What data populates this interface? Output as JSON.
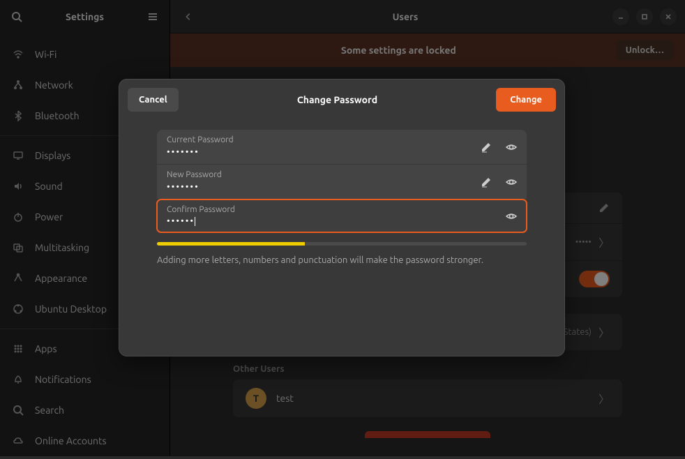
{
  "sidebar": {
    "title": "Settings",
    "items": [
      {
        "label": "Wi-Fi",
        "icon": "wifi"
      },
      {
        "label": "Network",
        "icon": "network"
      },
      {
        "label": "Bluetooth",
        "icon": "bluetooth"
      },
      {
        "divider": true
      },
      {
        "label": "Displays",
        "icon": "displays"
      },
      {
        "label": "Sound",
        "icon": "sound"
      },
      {
        "label": "Power",
        "icon": "power"
      },
      {
        "label": "Multitasking",
        "icon": "multitasking"
      },
      {
        "label": "Appearance",
        "icon": "appearance"
      },
      {
        "label": "Ubuntu Desktop",
        "icon": "ubuntu"
      },
      {
        "divider": true
      },
      {
        "label": "Apps",
        "icon": "apps"
      },
      {
        "label": "Notifications",
        "icon": "notifications"
      },
      {
        "label": "Search",
        "icon": "search"
      },
      {
        "label": "Online Accounts",
        "icon": "online"
      }
    ]
  },
  "main": {
    "title": "Users",
    "lock_banner": "Some settings are locked",
    "unlock_label": "Unlock…",
    "sections": {
      "other_users": "Other Users"
    },
    "rows": {
      "password_dots": "•••••",
      "language": "English (United States)"
    },
    "other_user": {
      "initial": "T",
      "name": "test"
    }
  },
  "dialog": {
    "title": "Change Password",
    "cancel": "Cancel",
    "change": "Change",
    "current_label": "Current Password",
    "new_label": "New Password",
    "confirm_label": "Confirm Password",
    "current_value": "•••••••",
    "new_value": "•••••••",
    "confirm_value": "••••••",
    "strength_hint": "Adding more letters, numbers and punctuation will make the password stronger."
  }
}
